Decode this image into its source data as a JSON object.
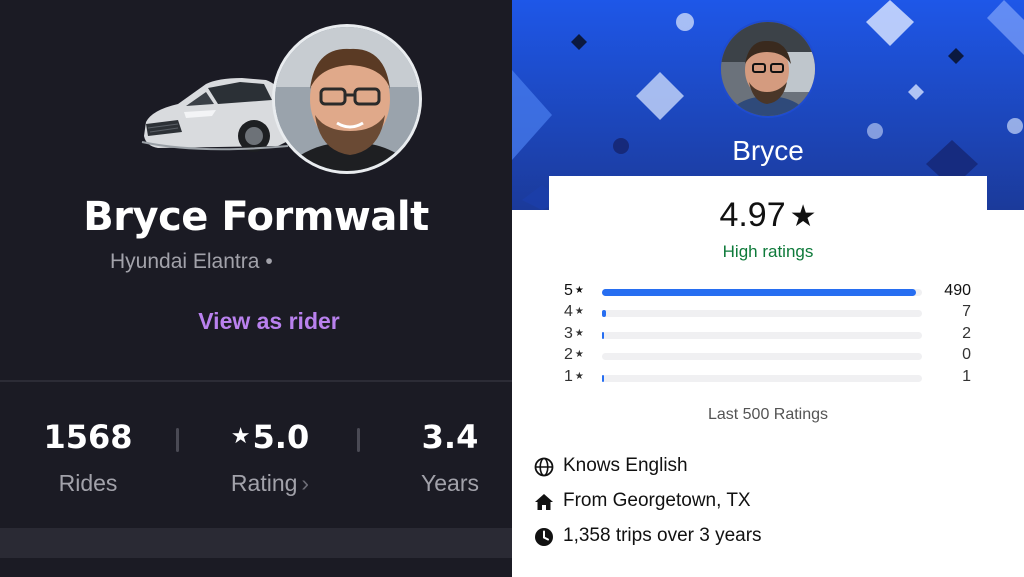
{
  "left": {
    "driver_name": "Bryce Formwalt",
    "vehicle": "Hyundai Elantra",
    "vehicle_separator": "•",
    "view_as_rider": "View as rider",
    "stats": [
      {
        "value": "1568",
        "label": "Rides"
      },
      {
        "value": "5.0",
        "label": "Rating",
        "prefix": "★",
        "chevron": "›"
      },
      {
        "value": "3.4",
        "label": "Years"
      }
    ],
    "colors": {
      "background": "#1b1b24",
      "accent": "#b981ee"
    }
  },
  "right": {
    "rider_name": "Bryce",
    "rating": "4.97",
    "rating_star": "★",
    "rating_caption": "High ratings",
    "breakdown": [
      {
        "stars": "5",
        "star_glyph": "★",
        "count": "490",
        "fraction": 0.98
      },
      {
        "stars": "4",
        "star_glyph": "★",
        "count": "7",
        "fraction": 0.014
      },
      {
        "stars": "3",
        "star_glyph": "★",
        "count": "2",
        "fraction": 0.006
      },
      {
        "stars": "2",
        "star_glyph": "★",
        "count": "0",
        "fraction": 0
      },
      {
        "stars": "1",
        "star_glyph": "★",
        "count": "1",
        "fraction": 0.003
      }
    ],
    "ratings_footer": "Last 500 Ratings",
    "info": [
      {
        "icon": "globe-icon",
        "text": "Knows English"
      },
      {
        "icon": "home-icon",
        "text": "From Georgetown, TX"
      },
      {
        "icon": "clock-icon",
        "text": "1,358 trips over 3 years"
      }
    ],
    "colors": {
      "hero_top": "#1e57e8",
      "hero_bottom": "#1b3a9a",
      "bar": "#276ef1",
      "caption": "#0e7a3a"
    }
  }
}
